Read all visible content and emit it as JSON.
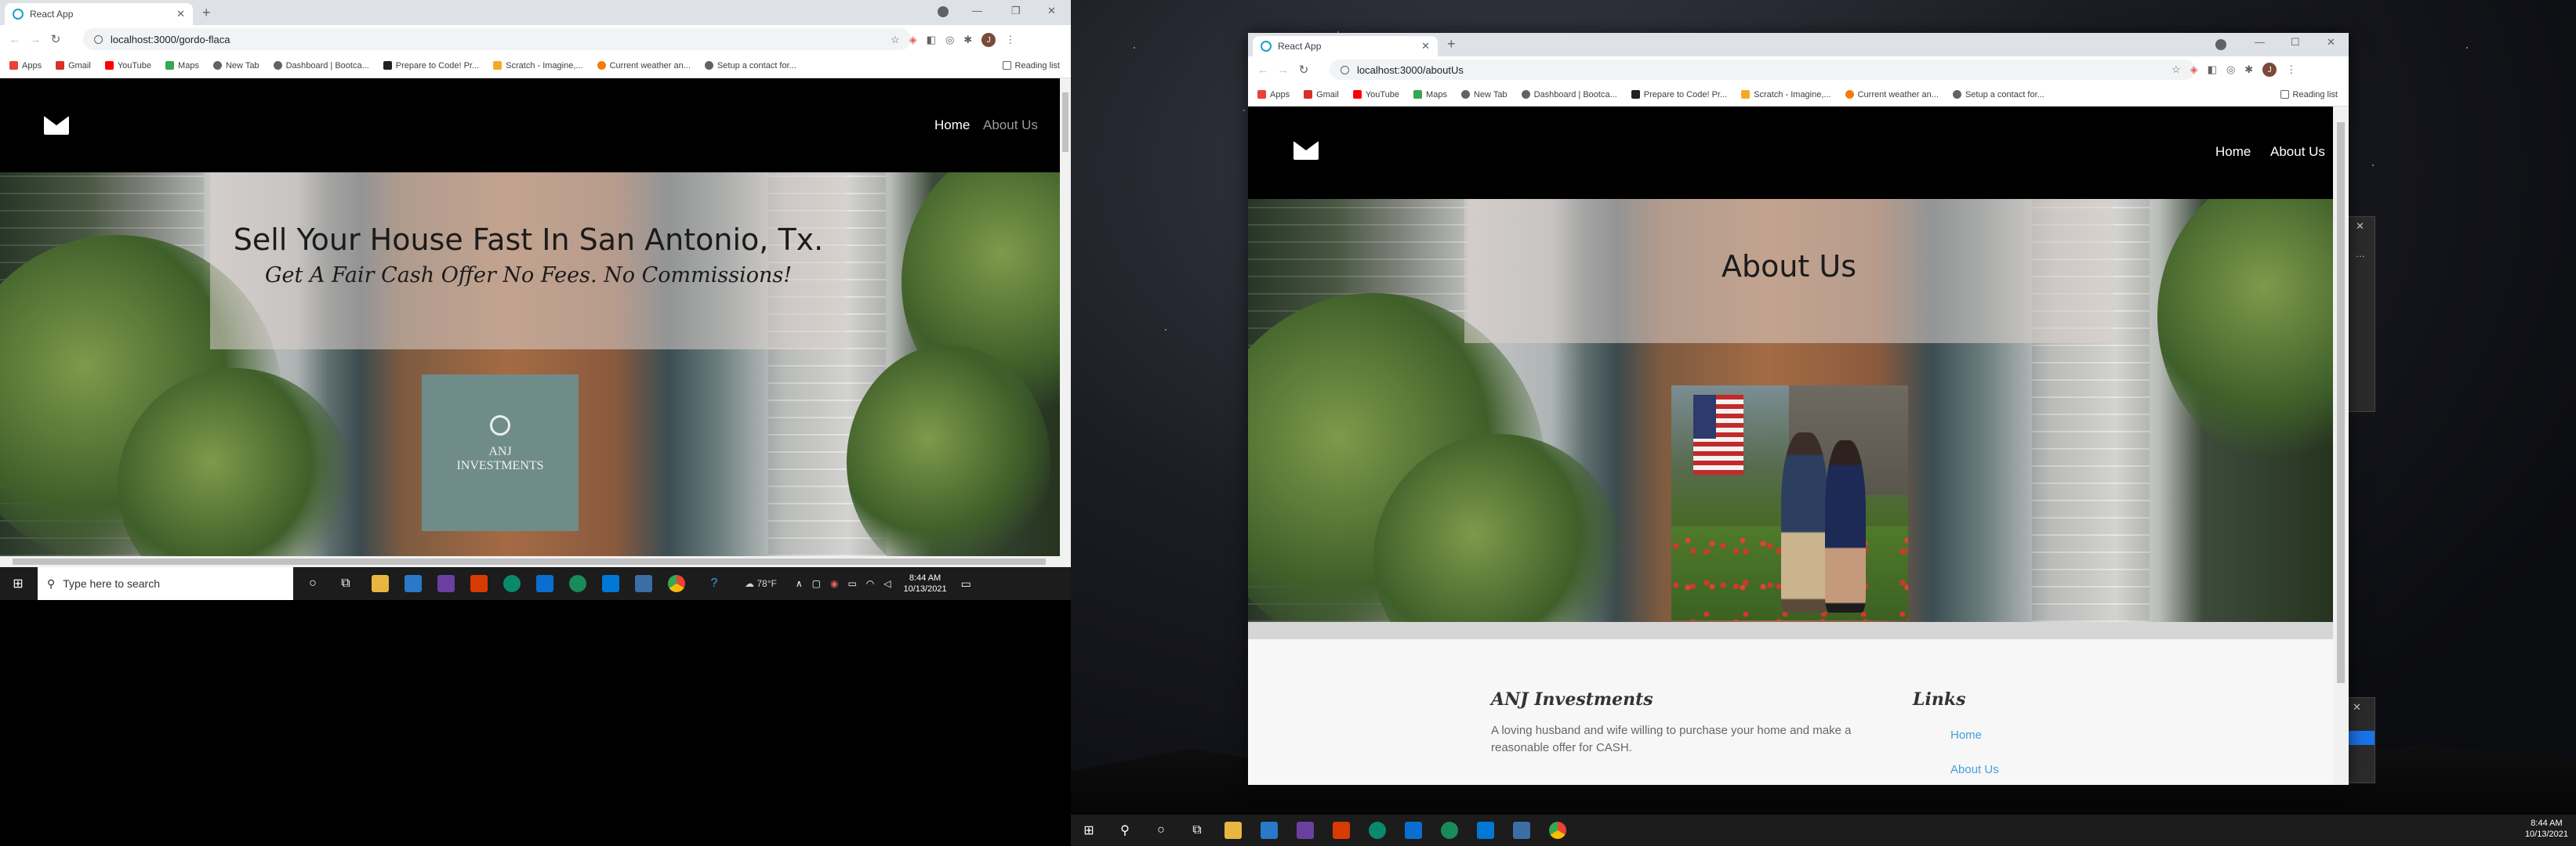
{
  "left_window": {
    "tab_title": "React App",
    "url": "localhost:3000/gordo-flaca",
    "bookmarks": [
      "Apps",
      "Gmail",
      "YouTube",
      "Maps",
      "New Tab",
      "Dashboard | Bootca...",
      "Prepare to Code! Pr...",
      "Scratch - Imagine,...",
      "Current weather an...",
      "Setup a contact for..."
    ],
    "reading_list": "Reading list",
    "avatar_letter": "J",
    "nav": {
      "home": "Home",
      "about": "About Us"
    },
    "hero": {
      "title": "Sell Your House Fast In San Antonio, Tx.",
      "subtitle": "Get A Fair Cash Offer No Fees. No Commissions!",
      "logo_line1": "ANJ",
      "logo_line2": "INVESTMENTS"
    },
    "taskbar": {
      "search_placeholder": "Type here to search",
      "weather": "78°F",
      "time": "8:44 AM",
      "date": "10/13/2021"
    }
  },
  "right_window": {
    "tab_title": "React App",
    "url": "localhost:3000/aboutUs",
    "bookmarks": [
      "Apps",
      "Gmail",
      "YouTube",
      "Maps",
      "New Tab",
      "Dashboard | Bootca...",
      "Prepare to Code! Pr...",
      "Scratch - Imagine,...",
      "Current weather an...",
      "Setup a contact for..."
    ],
    "reading_list": "Reading list",
    "avatar_letter": "J",
    "nav": {
      "home": "Home",
      "about": "About Us"
    },
    "page_title": "About Us",
    "footer": {
      "company_heading": "ANJ Investments",
      "company_text_line1": "A loving husband and wife willing to purchase your home and make a",
      "company_text_line2": "reasonable offer for CASH.",
      "links_heading": "Links",
      "link_home": "Home",
      "link_about": "About Us"
    }
  },
  "right_taskbar": {
    "time": "8:44 AM",
    "date": "10/13/2021"
  },
  "colors": {
    "chrome_tabbar": "#dee1e6",
    "nav_bg": "#000000",
    "logo_box": "#6f8c88",
    "link_blue": "#3ea0e0",
    "taskbar": "#1c1c1c"
  },
  "icons": [
    "react-favicon-icon",
    "close-icon",
    "plus-icon",
    "back-icon",
    "forward-icon",
    "reload-icon",
    "info-icon",
    "star-icon",
    "extension-icon",
    "envelope-icon",
    "windows-start-icon",
    "search-icon",
    "cortana-icon",
    "task-view-icon",
    "chrome-icon",
    "vscode-icon",
    "edge-icon"
  ]
}
